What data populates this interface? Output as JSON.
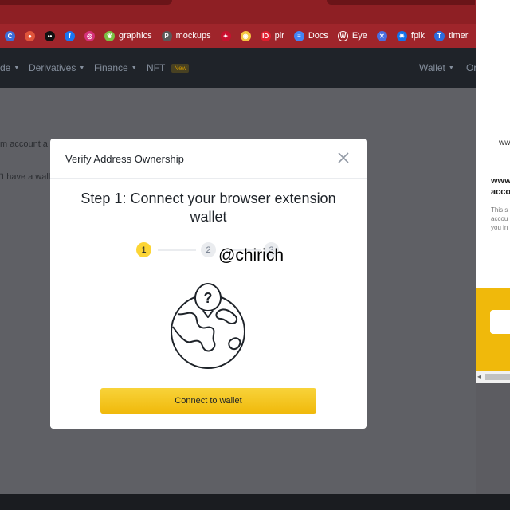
{
  "bookmarks": [
    {
      "icon": "c-circle-icon",
      "label": "",
      "color": "#3b6fd8",
      "glyph": "C"
    },
    {
      "icon": "chrome-icon",
      "label": "",
      "color": "#e0553b",
      "glyph": "●"
    },
    {
      "icon": "dots-icon",
      "label": "",
      "color": "#111111",
      "glyph": "••"
    },
    {
      "icon": "facebook-icon",
      "label": "",
      "color": "#1877f2",
      "glyph": "f"
    },
    {
      "icon": "instagram-icon",
      "label": "",
      "color": "#d6317a",
      "glyph": "◎"
    },
    {
      "icon": "leaf-icon",
      "label": "graphics",
      "color": "#7ac143",
      "glyph": "❦"
    },
    {
      "icon": "pinterest-icon",
      "label": "mockups",
      "color": "#5a5a5a",
      "glyph": "P"
    },
    {
      "icon": "red-logo-icon",
      "label": "",
      "color": "#c8102e",
      "glyph": "✦"
    },
    {
      "icon": "eye-logo-icon",
      "label": "",
      "color": "#f5c542",
      "glyph": "◉"
    },
    {
      "icon": "id-icon",
      "label": "plr",
      "color": "#e11d2e",
      "glyph": "ID"
    },
    {
      "icon": "docs-icon",
      "label": "Docs",
      "color": "#4285f4",
      "glyph": "≡"
    },
    {
      "icon": "wordpress-icon",
      "label": "Eye",
      "color": "#ffffff",
      "glyph": "W"
    },
    {
      "icon": "x-logo-icon",
      "label": "",
      "color": "#4a6ee0",
      "glyph": "✕"
    },
    {
      "icon": "freepik-icon",
      "label": "fpik",
      "color": "#1273eb",
      "glyph": "✸"
    },
    {
      "icon": "t-icon",
      "label": "timer",
      "color": "#2b6cde",
      "glyph": "T"
    }
  ],
  "nav": {
    "item_partial": "de",
    "derivatives": "Derivatives",
    "finance": "Finance",
    "nft": "NFT",
    "nft_badge": "New",
    "wallet": "Wallet",
    "trailing_partial": "Or"
  },
  "background": {
    "line1": "m account a",
    "line2": "'t have a wall"
  },
  "extension": {
    "domain_partial": "ww",
    "heading_line1": "www",
    "heading_line2": "acco",
    "body_line1": "This s",
    "body_line2": "accou",
    "body_line3": "you in"
  },
  "modal": {
    "title": "Verify Address Ownership",
    "step_title": "Step 1: Connect your browser extension wallet",
    "steps": [
      "1",
      "2",
      "3"
    ],
    "watermark": "@chirich",
    "connect_button": "Connect to wallet"
  },
  "colors": {
    "accent": "#f0b90b",
    "overlay": "#5f6065",
    "header_dark": "#1f2329"
  }
}
